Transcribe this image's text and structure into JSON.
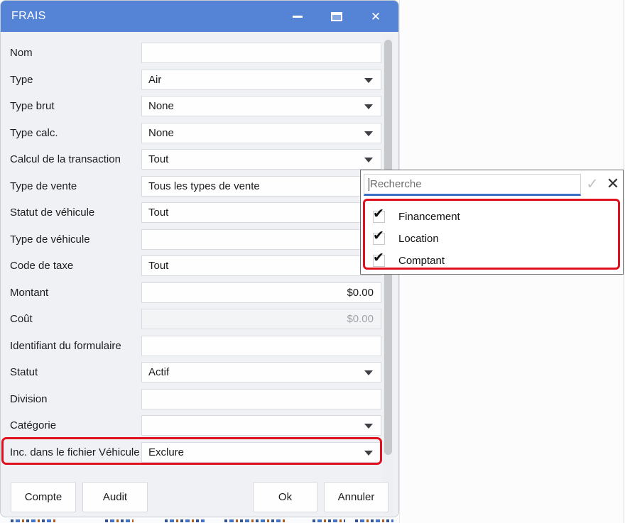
{
  "window": {
    "title": "FRAIS"
  },
  "icons": {
    "minimize": "minimize-bar",
    "maximize": "maximize-square",
    "close": "✕",
    "search_confirm": "✓",
    "search_clear": "✕",
    "dropdown_arrow": "▼",
    "checkbox_check": "✔"
  },
  "form": {
    "rows": [
      {
        "label": "Nom",
        "value": "",
        "kind": "input"
      },
      {
        "label": "Type",
        "value": "Air",
        "kind": "select"
      },
      {
        "label": "Type brut",
        "value": "None",
        "kind": "select"
      },
      {
        "label": "Type calc.",
        "value": "None",
        "kind": "select"
      },
      {
        "label": "Calcul de la transaction",
        "value": "Tout",
        "kind": "select"
      },
      {
        "label": "Type de vente",
        "value": "Tous les types de vente",
        "kind": "select"
      },
      {
        "label": "Statut de véhicule",
        "value": "Tout",
        "kind": "select"
      },
      {
        "label": "Type de véhicule",
        "value": "",
        "kind": "input"
      },
      {
        "label": "Code de taxe",
        "value": "Tout",
        "kind": "select"
      },
      {
        "label": "Montant",
        "value": "$0.00",
        "kind": "input",
        "align": "right"
      },
      {
        "label": "Coût",
        "value": "$0.00",
        "kind": "input",
        "align": "right",
        "muted": true
      },
      {
        "label": "Identifiant du formulaire",
        "value": "",
        "kind": "input"
      },
      {
        "label": "Statut",
        "value": "Actif",
        "kind": "select"
      },
      {
        "label": "Division",
        "value": "",
        "kind": "input"
      },
      {
        "label": "Catégorie",
        "value": "",
        "kind": "select"
      },
      {
        "label": "Inc. dans le fichier Véhicule",
        "value": "Exclure",
        "kind": "select",
        "highlighted": true
      }
    ]
  },
  "popup": {
    "search_placeholder": "Recherche",
    "items": [
      {
        "label": "Financement",
        "checked": true
      },
      {
        "label": "Location",
        "checked": true
      },
      {
        "label": "Comptant",
        "checked": true
      }
    ]
  },
  "buttons": {
    "left": [
      "Compte",
      "Audit"
    ],
    "right": [
      "Ok",
      "Annuler"
    ]
  },
  "colors": {
    "titlebar": "#5584D6",
    "dialog_background": "#EFF1F5",
    "highlight_red": "#E0101E",
    "search_underline": "#3E6DC6"
  }
}
